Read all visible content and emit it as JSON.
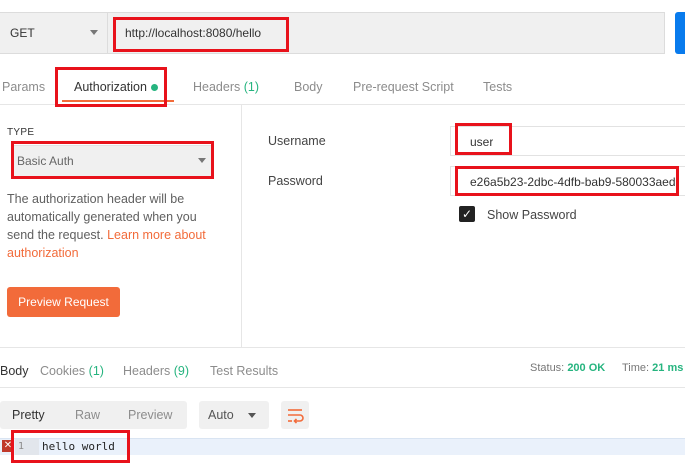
{
  "request": {
    "method": "GET",
    "url": "http://localhost:8080/hello"
  },
  "tabs": [
    {
      "label": "Params",
      "count": ""
    },
    {
      "label": "Authorization",
      "count": ""
    },
    {
      "label": "Headers",
      "count": "(1)"
    },
    {
      "label": "Body",
      "count": ""
    },
    {
      "label": "Pre-request Script",
      "count": ""
    },
    {
      "label": "Tests",
      "count": ""
    }
  ],
  "auth": {
    "type_label": "TYPE",
    "type_value": "Basic Auth",
    "description": "The authorization header will be automatically generated when you send the request.",
    "learn_more": "Learn more about authorization",
    "preview_button": "Preview Request",
    "username_label": "Username",
    "username_value": "user",
    "password_label": "Password",
    "password_value": "e26a5b23-2dbc-4dfb-bab9-580033aed",
    "show_password_label": "Show Password"
  },
  "response": {
    "tabs": [
      {
        "label": "Body",
        "count": ""
      },
      {
        "label": "Cookies",
        "count": "(1)"
      },
      {
        "label": "Headers",
        "count": "(9)"
      },
      {
        "label": "Test Results",
        "count": ""
      }
    ],
    "status_label": "Status:",
    "status_value": "200 OK",
    "time_label": "Time:",
    "time_value": "21 ms",
    "formats": [
      "Pretty",
      "Raw",
      "Preview"
    ],
    "language": "Auto",
    "line_number": "1",
    "body": "hello world"
  },
  "colors": {
    "accent": "#f26b3a",
    "success": "#26b47f",
    "highlight": "#e8121b"
  }
}
